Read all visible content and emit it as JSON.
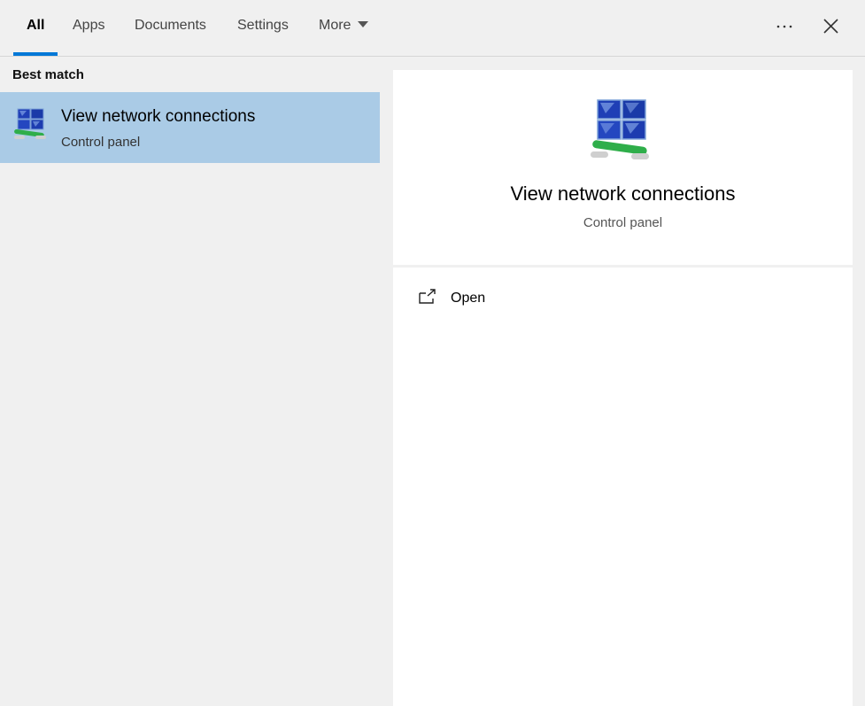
{
  "tabs": [
    {
      "label": "All",
      "active": true
    },
    {
      "label": "Apps"
    },
    {
      "label": "Documents"
    },
    {
      "label": "Settings"
    },
    {
      "label": "More"
    }
  ],
  "toolbar": {
    "more_options_icon": "ellipsis-icon",
    "close_icon": "close-icon"
  },
  "results": {
    "section_label": "Best match",
    "items": [
      {
        "title": "View network connections",
        "subtitle": "Control panel",
        "icon": "network-connections-icon"
      }
    ]
  },
  "detail": {
    "title": "View network connections",
    "subtitle": "Control panel",
    "icon": "network-connections-icon",
    "actions": [
      {
        "label": "Open",
        "icon": "open-external-icon"
      }
    ]
  },
  "colors": {
    "accent": "#0078d7",
    "selected_bg": "#aacbe6",
    "background": "#f0f0f0"
  }
}
